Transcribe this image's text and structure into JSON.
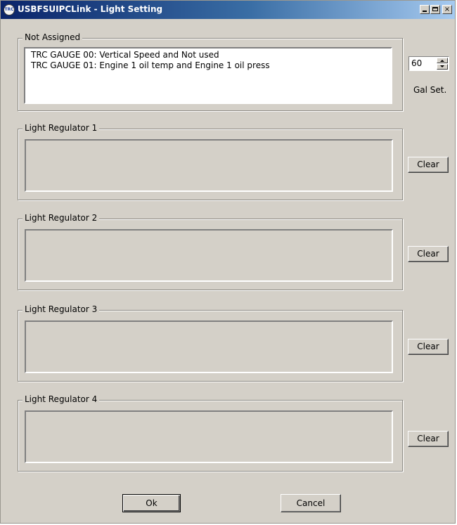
{
  "window": {
    "title": "USBFSUIPCLink - Light Setting",
    "app_icon_text": "TRC",
    "controls": {
      "minimize": "_",
      "maximize": "□",
      "close": "×"
    }
  },
  "not_assigned": {
    "legend": "Not Assigned",
    "items": [
      "TRC GAUGE 00: Vertical Speed and Not used",
      "TRC GAUGE 01: Engine 1 oil temp and Engine 1 oil press"
    ]
  },
  "gal_set": {
    "value": "60",
    "label": "Gal Set."
  },
  "regulators": [
    {
      "legend": "Light Regulator 1",
      "clear_label": "Clear"
    },
    {
      "legend": "Light Regulator 2",
      "clear_label": "Clear"
    },
    {
      "legend": "Light Regulator 3",
      "clear_label": "Clear"
    },
    {
      "legend": "Light Regulator 4",
      "clear_label": "Clear"
    }
  ],
  "buttons": {
    "ok_label": "Ok",
    "cancel_label": "Cancel"
  }
}
